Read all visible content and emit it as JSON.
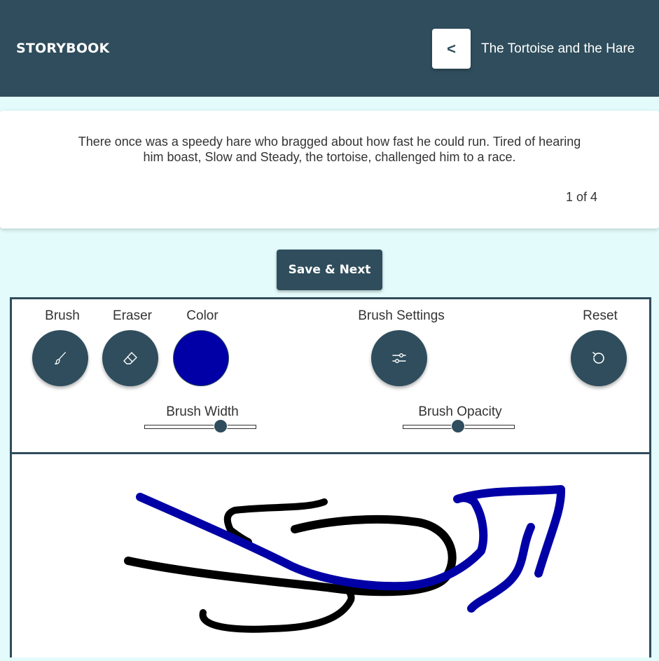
{
  "header": {
    "brand": "STORYBOOK",
    "back_label": "<",
    "story_title": "The Tortoise and the Hare"
  },
  "story": {
    "text": "There once was a speedy hare who bragged about how fast he could run. Tired of hearing him boast, Slow and Steady, the tortoise, challenged him to a race.",
    "page_indicator": "1 of 4"
  },
  "actions": {
    "save_next_label": "Save & Next"
  },
  "toolbar": {
    "brush_label": "Brush",
    "eraser_label": "Eraser",
    "color_label": "Color",
    "brush_settings_label": "Brush Settings",
    "reset_label": "Reset",
    "brush_width_label": "Brush Width",
    "brush_opacity_label": "Brush Opacity",
    "selected_color": "#0000a6",
    "brush_width_value": 0.68,
    "brush_opacity_value": 0.49
  },
  "icons": {
    "brush": "brush-icon",
    "eraser": "eraser-icon",
    "settings": "sliders-icon",
    "reset": "reset-icon"
  },
  "colors": {
    "header": "#2f4d5c",
    "page_background": "#e3fbfb",
    "stroke_black": "#000000",
    "stroke_blue": "#0000a6"
  }
}
